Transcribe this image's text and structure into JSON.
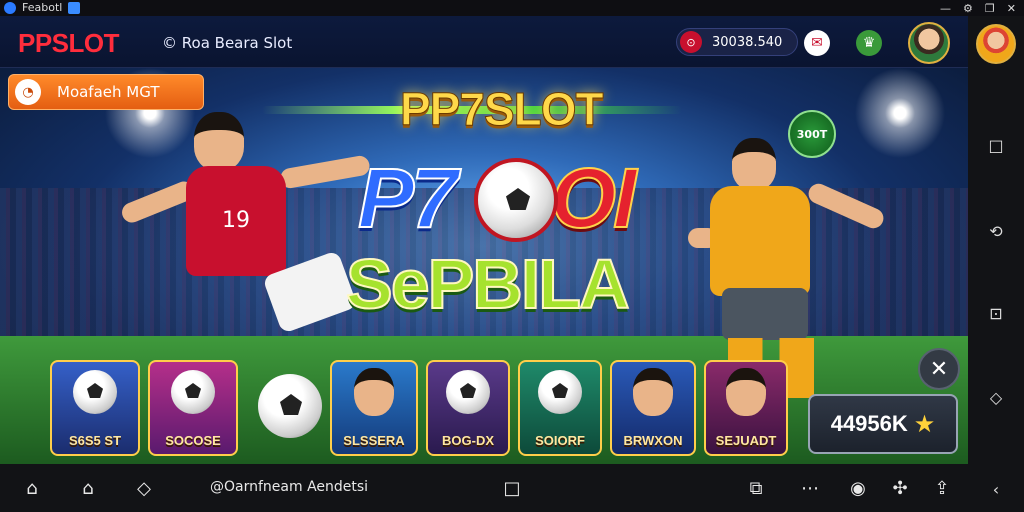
{
  "os_bar": {
    "app_name": "Feabotl",
    "icons": [
      "minimize-icon",
      "settings-icon",
      "restore-icon",
      "close-icon"
    ]
  },
  "header": {
    "logo_text": "PPSLOT",
    "subtitle": "© Roa Beara Slot",
    "balance": "30038.540",
    "icons": [
      "coin-icon",
      "chat-icon",
      "trophy-icon"
    ]
  },
  "promo": {
    "label": "Moafaeh MGT"
  },
  "game": {
    "title_top": "PP7SLOT",
    "title_mid_left": "P7",
    "title_mid_right": "OI",
    "title_bottom": "SePBILA",
    "badge": "300T",
    "player1_number": "19"
  },
  "cards": [
    {
      "label": "S6S5 ST"
    },
    {
      "label": "SOCOSE"
    },
    {
      "label": "SLSSERA"
    },
    {
      "label": "BOG-DX"
    },
    {
      "label": "SOIORF"
    },
    {
      "label": "BRWXON"
    },
    {
      "label": "SEJUADT"
    }
  ],
  "jackpot": {
    "value": "44956K"
  },
  "bottom_nav": {
    "center_text": "@Oarnfneam Aendetsi"
  },
  "colors": {
    "header_bg": "#0d1a3d",
    "accent_orange": "#ff8a2a",
    "brand_red": "#ff2d3c",
    "gold": "#ffd84a"
  }
}
